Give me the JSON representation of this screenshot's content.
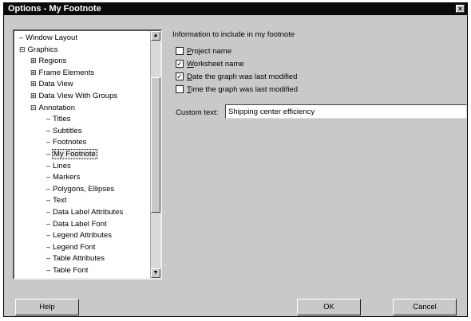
{
  "window": {
    "title": "Options - My Footnote",
    "close_glyph": "×"
  },
  "tree": {
    "items": [
      {
        "label": "Window Layout",
        "prefix": "–",
        "icon": "tree-line"
      },
      {
        "label": "Graphics",
        "prefix": "⊟",
        "icon": "collapse-icon"
      },
      {
        "label": "Regions",
        "prefix": "⊞",
        "icon": "expand-icon"
      },
      {
        "label": "Frame Elements",
        "prefix": "⊞",
        "icon": "expand-icon"
      },
      {
        "label": "Data View",
        "prefix": "⊞",
        "icon": "expand-icon"
      },
      {
        "label": "Data View With Groups",
        "prefix": "⊞",
        "icon": "expand-icon"
      },
      {
        "label": "Annotation",
        "prefix": "⊟",
        "icon": "collapse-icon"
      },
      {
        "label": "Titles",
        "prefix": "–",
        "icon": "tree-line"
      },
      {
        "label": "Subtitles",
        "prefix": "–",
        "icon": "tree-line"
      },
      {
        "label": "Footnotes",
        "prefix": "–",
        "icon": "tree-line"
      },
      {
        "label": "My Footnote",
        "prefix": "–",
        "icon": "tree-line"
      },
      {
        "label": "Lines",
        "prefix": "–",
        "icon": "tree-line"
      },
      {
        "label": "Markers",
        "prefix": "–",
        "icon": "tree-line"
      },
      {
        "label": "Polygons, Ellipses",
        "prefix": "–",
        "icon": "tree-line"
      },
      {
        "label": "Text",
        "prefix": "–",
        "icon": "tree-line"
      },
      {
        "label": "Data Label Attributes",
        "prefix": "–",
        "icon": "tree-line"
      },
      {
        "label": "Data Label Font",
        "prefix": "–",
        "icon": "tree-line"
      },
      {
        "label": "Legend Attributes",
        "prefix": "–",
        "icon": "tree-line"
      },
      {
        "label": "Legend Font",
        "prefix": "–",
        "icon": "tree-line"
      },
      {
        "label": "Table Attributes",
        "prefix": "–",
        "icon": "tree-line"
      },
      {
        "label": "Table Font",
        "prefix": "–",
        "icon": "tree-line"
      }
    ],
    "selected_label": "My Footnote",
    "scroll_up_glyph": "▲",
    "scroll_down_glyph": "▼"
  },
  "footnote": {
    "group_label": "Information to include in my footnote",
    "options": [
      {
        "label": "Project name",
        "checked": false,
        "key": "P",
        "rest": "roject name"
      },
      {
        "label": "Worksheet name",
        "checked": true,
        "key": "W",
        "rest": "orksheet name"
      },
      {
        "label": "Date the graph was last modified",
        "checked": true,
        "key": "D",
        "rest": "ate the graph was last modified"
      },
      {
        "label": "Time the graph was last modified",
        "checked": false,
        "key": "T",
        "rest": "ime the graph was last modified"
      }
    ],
    "check_glyph": "✓",
    "custom_text_label": "Custom text:",
    "custom_text_value": "Shipping center efficiency"
  },
  "buttons": {
    "help": "Help",
    "ok": "OK",
    "cancel": "Cancel"
  }
}
